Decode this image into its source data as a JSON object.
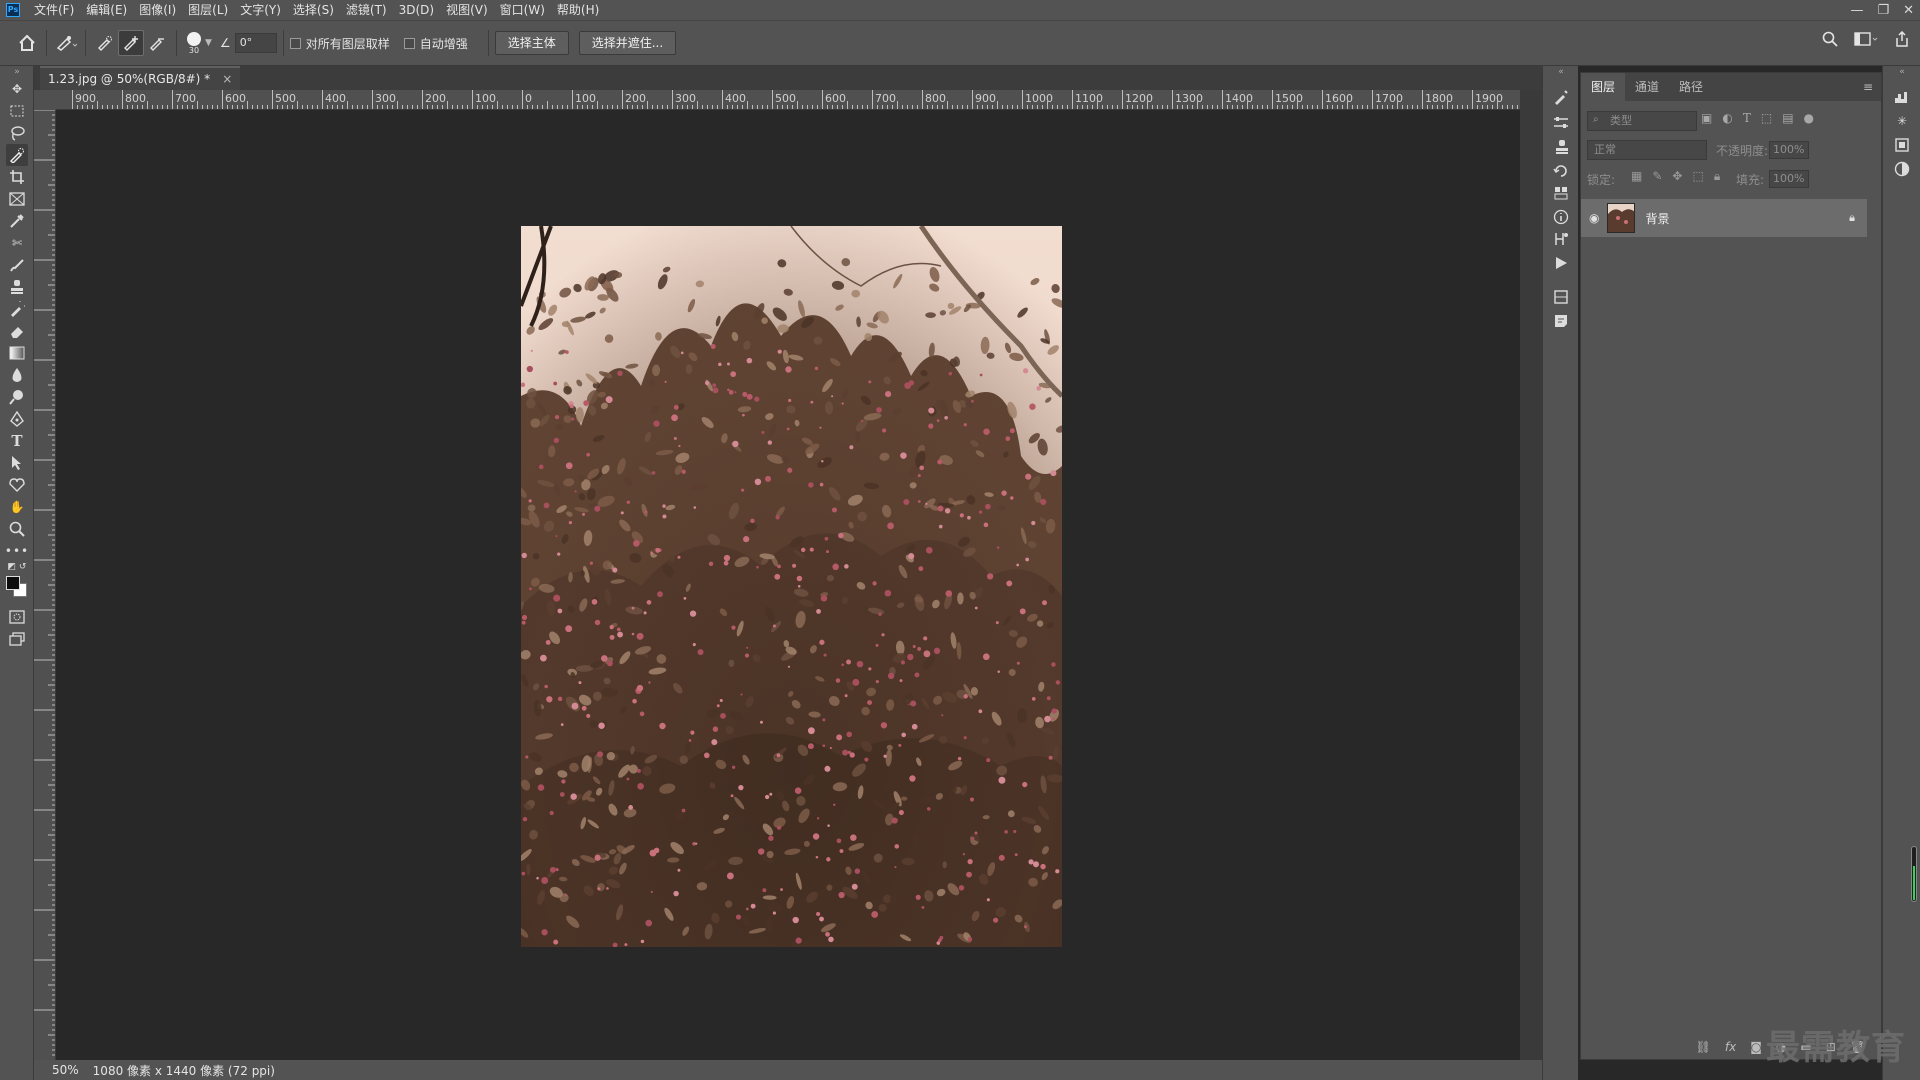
{
  "app": {
    "logo": "Ps"
  },
  "menu": [
    "文件(F)",
    "编辑(E)",
    "图像(I)",
    "图层(L)",
    "文字(Y)",
    "选择(S)",
    "滤镜(T)",
    "3D(D)",
    "视图(V)",
    "窗口(W)",
    "帮助(H)"
  ],
  "options": {
    "brush_size": "30",
    "angle": "0°",
    "sample_all_layers": "对所有图层取样",
    "auto_enhance": "自动增强",
    "select_subject": "选择主体",
    "select_and_mask": "选择并遮住..."
  },
  "document": {
    "tab_title": "1.23.jpg @ 50%(RGB/8#) *",
    "close": "×"
  },
  "ruler": {
    "top_labels": [
      "900",
      "800",
      "700",
      "600",
      "500",
      "400",
      "300",
      "200",
      "100",
      "0",
      "100",
      "200",
      "300",
      "400",
      "500",
      "600",
      "700",
      "800",
      "900",
      "1000",
      "1100",
      "1200",
      "1300",
      "1400",
      "1500",
      "1600",
      "1700",
      "1800",
      "1900"
    ]
  },
  "status": {
    "zoom": "50%",
    "info": "1080 像素 x 1440 像素 (72 ppi)"
  },
  "layers_panel": {
    "tabs": [
      "图层",
      "通道",
      "路径"
    ],
    "filter_placeholder": "类型",
    "blend_mode": "正常",
    "opacity_label": "不透明度:",
    "opacity_value": "100%",
    "lock_label": "锁定:",
    "fill_label": "填充:",
    "fill_value": "100%",
    "layer_name": "背景"
  },
  "watermark": "最需教育"
}
